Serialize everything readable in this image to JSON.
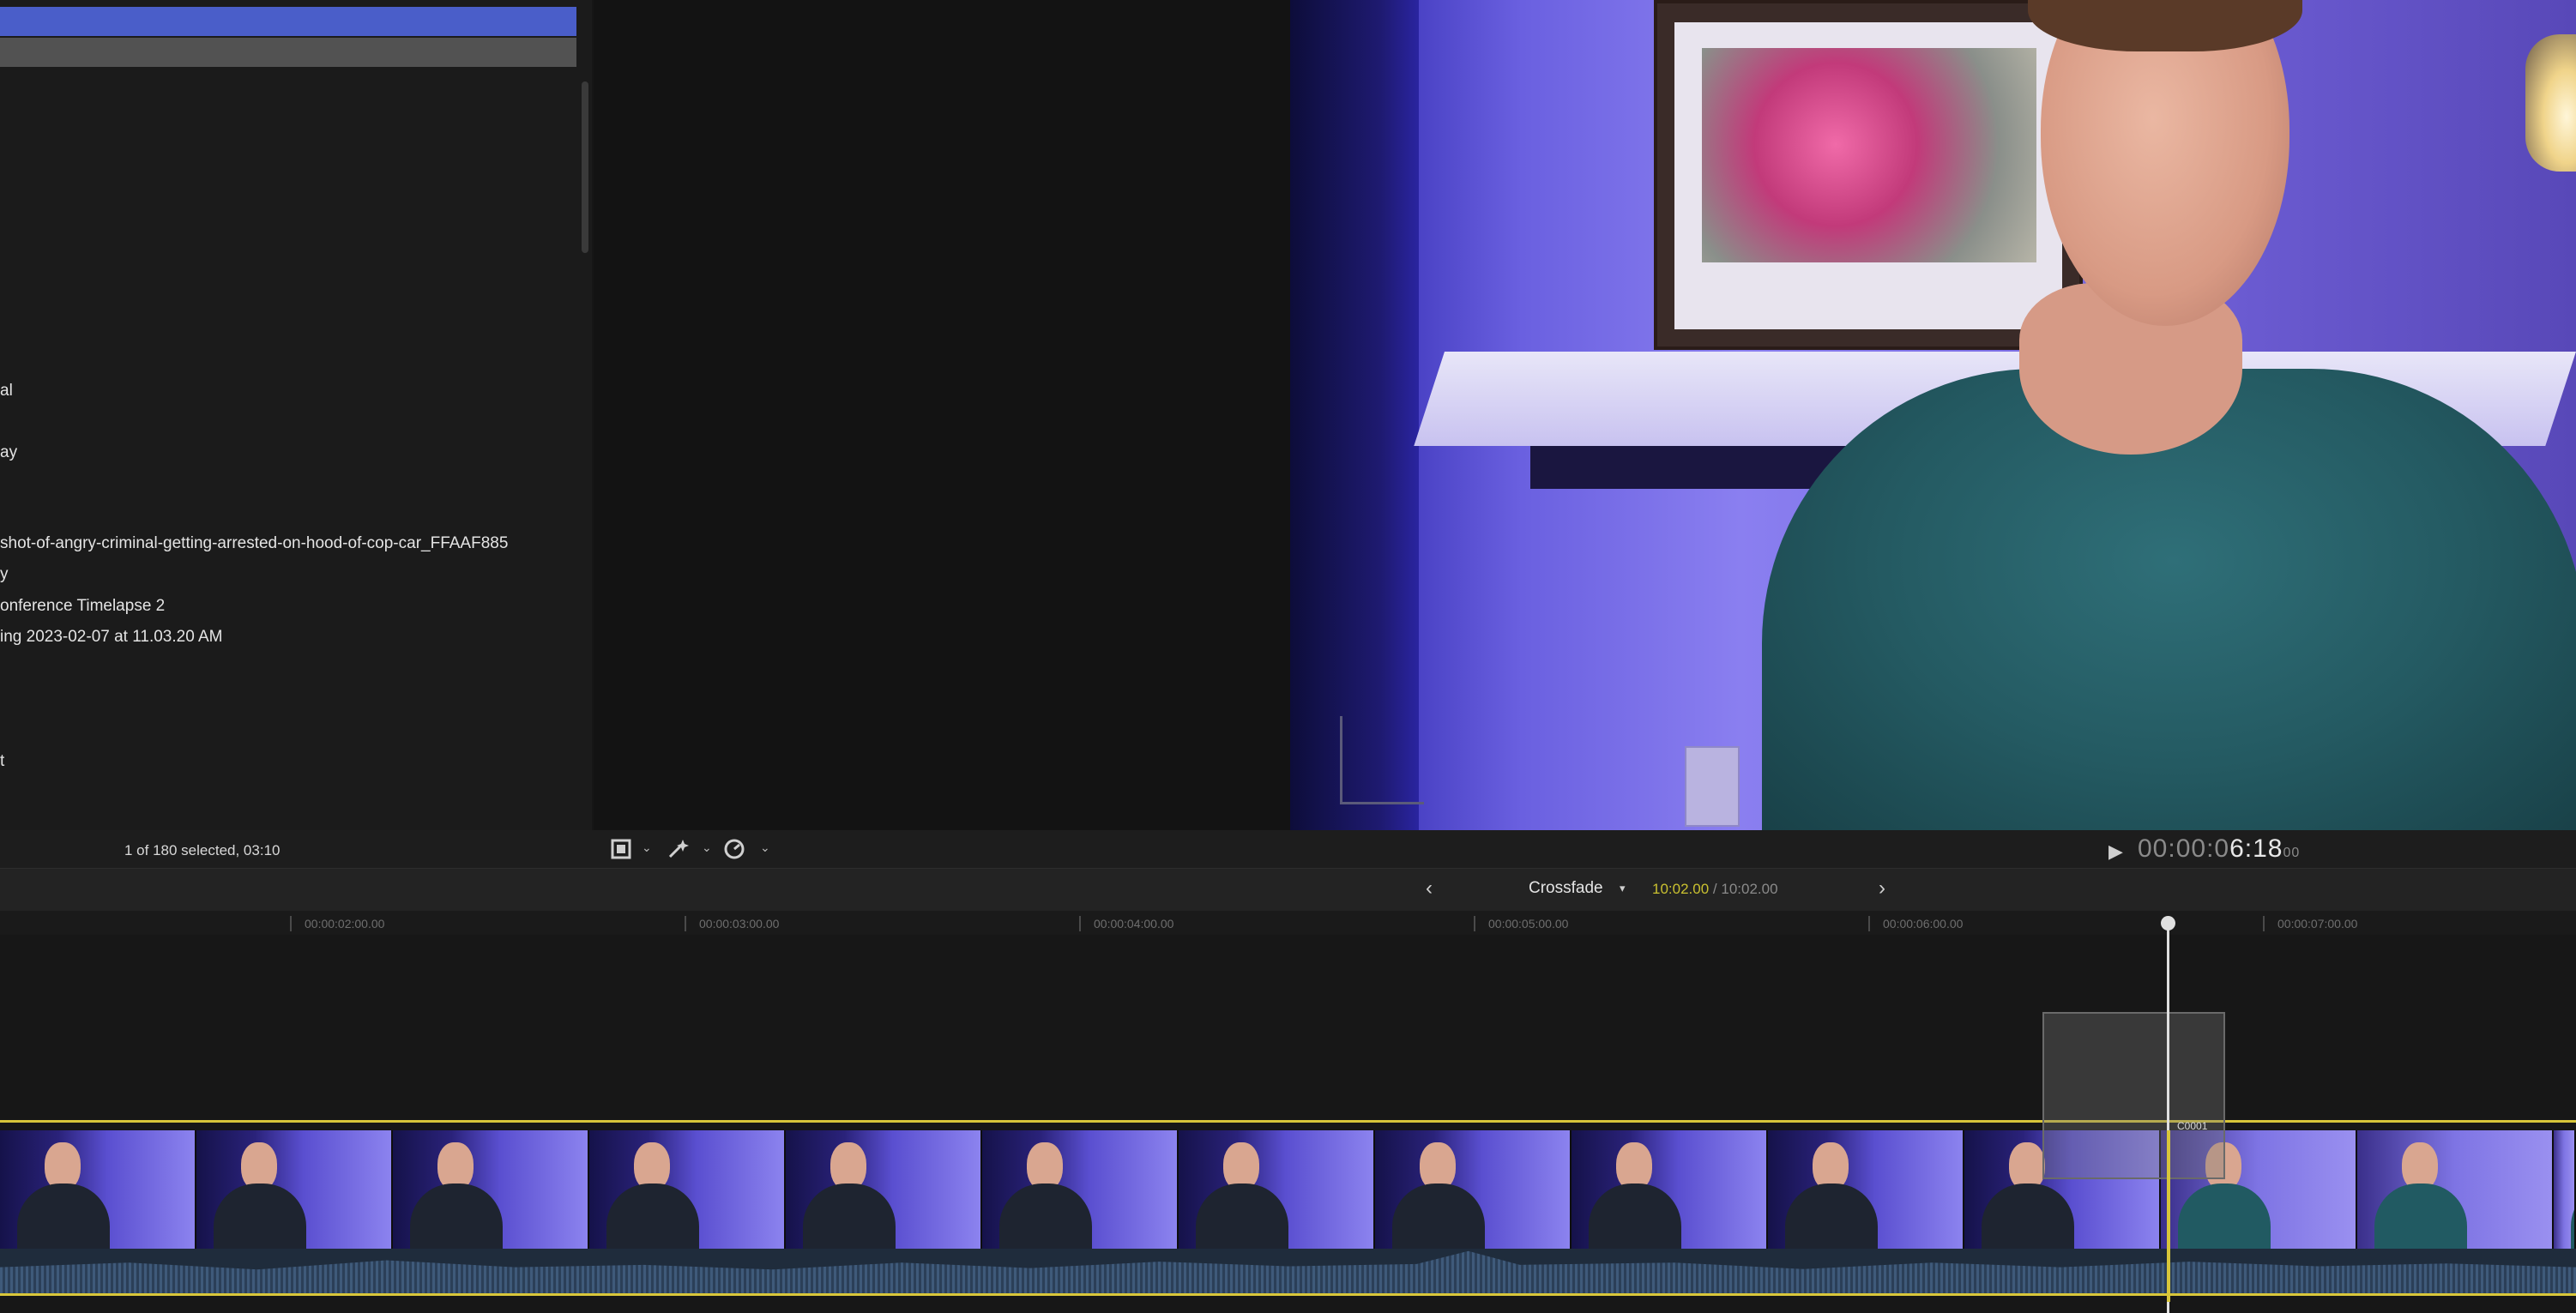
{
  "browser": {
    "rows": [
      {
        "label": "al"
      },
      {
        "label": "ay"
      },
      {
        "label": "shot-of-angry-criminal-getting-arrested-on-hood-of-cop-car_FFAAF885"
      },
      {
        "label": "y"
      },
      {
        "label": "onference Timelapse 2"
      },
      {
        "label": "ing 2023-02-07 at 11.03.20 AM"
      },
      {
        "label": "t"
      }
    ],
    "status": "1 of 180 selected, 03:10"
  },
  "toolbar": {
    "transform_icon": "crop-transform-icon",
    "enhance_icon": "magic-wand-icon",
    "speed_icon": "speedometer-icon"
  },
  "viewer": {
    "play_icon": "play-icon",
    "timecode_prefix": "00:00:0",
    "timecode_main": "6:18",
    "timecode_frames": "00"
  },
  "timeline_header": {
    "prev_icon": "chevron-left-icon",
    "next_icon": "chevron-right-icon",
    "effect_name": "Crossfade",
    "duration_current": "10:02.00",
    "duration_separator": " / ",
    "duration_total": "10:02.00"
  },
  "ruler": {
    "ticks": [
      "00:00:02:00.00",
      "00:00:03:00.00",
      "00:00:04:00.00",
      "00:00:05:00.00",
      "00:00:06:00.00",
      "00:00:07:00.00"
    ]
  },
  "timeline": {
    "clip_label": "C0001"
  }
}
